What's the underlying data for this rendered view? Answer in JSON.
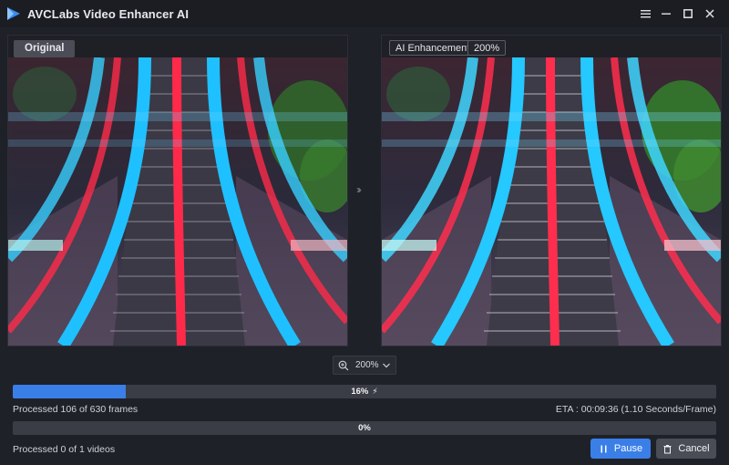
{
  "app": {
    "title": "AVCLabs Video Enhancer AI",
    "accent_color": "#3a7fe8"
  },
  "window_controls": {
    "icons": [
      "hamburger-menu-icon",
      "minimize-icon",
      "maximize-icon",
      "close-icon"
    ]
  },
  "preview": {
    "left_label": "Original",
    "right_label": "AI Enhancement",
    "right_zoom": "200%",
    "divider_icon": "double-chevron-right-icon"
  },
  "zoom": {
    "value": "200%",
    "icon": "zoom-in-icon",
    "dropdown_icon": "chevron-down-icon"
  },
  "progress": {
    "frames": {
      "percent": 16,
      "label": "16%",
      "status": "Processed 106 of 630 frames",
      "eta": "ETA : 00:09:36 (1.10 Seconds/Frame)",
      "icon": "lightning-icon"
    },
    "videos": {
      "percent": 0,
      "label": "0%",
      "status": "Processed 0 of 1 videos"
    }
  },
  "actions": {
    "pause_label": "Pause",
    "cancel_label": "Cancel"
  }
}
